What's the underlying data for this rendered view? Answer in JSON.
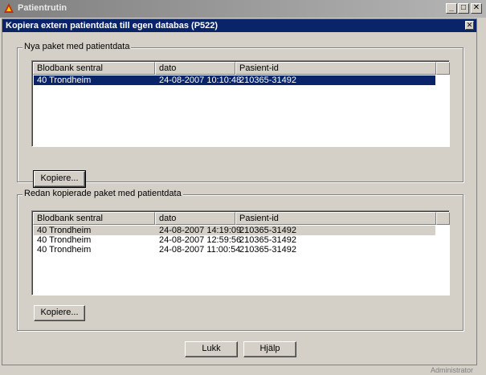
{
  "app": {
    "title": "Patientrutin",
    "controls": {
      "minimize": "_",
      "maximize": "□",
      "close": "✕"
    }
  },
  "dialog": {
    "title": "Kopiera extern patientdata till egen databas (P522)",
    "close": "✕"
  },
  "new_packages": {
    "legend": "Nya paket med patientdata",
    "columns": [
      "Blodbank sentral",
      "dato",
      "Pasient-id"
    ],
    "rows": [
      {
        "sentral": "40 Trondheim",
        "dato": "24-08-2007 10:10:48",
        "pasient": "210365-31492",
        "selected": true
      }
    ],
    "copy_label": "Kopiere..."
  },
  "copied_packages": {
    "legend": "Redan kopierade paket med patientdata",
    "columns": [
      "Blodbank sentral",
      "dato",
      "Pasient-id"
    ],
    "rows": [
      {
        "sentral": "40 Trondheim",
        "dato": "24-08-2007 14:19:09",
        "pasient": "210365-31492"
      },
      {
        "sentral": "40 Trondheim",
        "dato": "24-08-2007 12:59:56",
        "pasient": "210365-31492"
      },
      {
        "sentral": "40 Trondheim",
        "dato": "24-08-2007 11:00:54",
        "pasient": "210365-31492"
      }
    ],
    "copy_label": "Kopiere..."
  },
  "footer": {
    "close_label": "Lukk",
    "help_label": "Hjälp"
  },
  "statusbar": {
    "text": "Administrator"
  },
  "colors": {
    "selection": "#0a246a",
    "face": "#d4d0c8"
  },
  "icons": {
    "app": "app-logo-icon"
  }
}
